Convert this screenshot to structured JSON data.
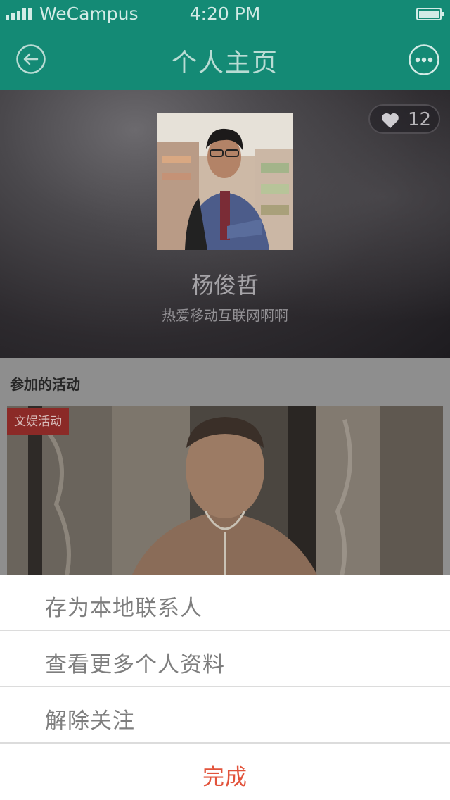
{
  "status_bar": {
    "carrier": "WeCampus",
    "time": "4:20 PM"
  },
  "nav": {
    "title": "个人主页",
    "back_icon": "back-arrow-icon",
    "more_icon": "more-dots-icon"
  },
  "profile": {
    "likes": "12",
    "name": "杨俊哲",
    "bio": "热爱移动互联网啊啊"
  },
  "activities": {
    "section_title": "参加的活动",
    "items": [
      {
        "tag": "文娱活动"
      }
    ]
  },
  "action_sheet": {
    "items": [
      "存为本地联系人",
      "查看更多个人资料",
      "解除关注"
    ],
    "done": "完成"
  },
  "colors": {
    "primary": "#148a75",
    "accent": "#e2533b",
    "tag": "#8b2a27"
  }
}
